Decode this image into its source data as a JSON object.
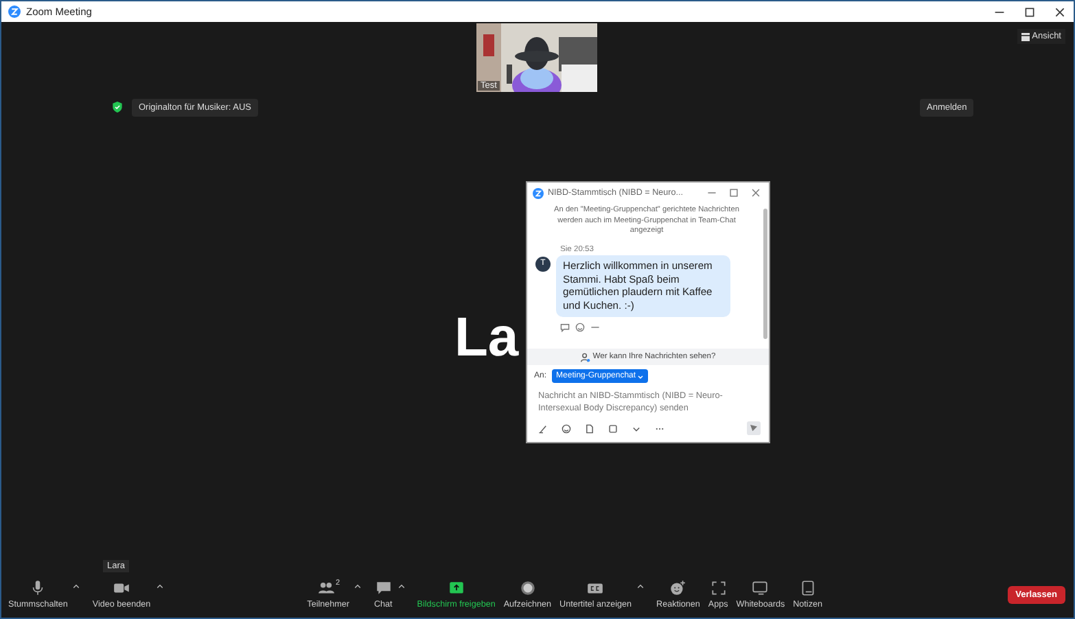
{
  "window": {
    "title": "Zoom Meeting"
  },
  "view_button": {
    "label": "Ansicht"
  },
  "video_tile": {
    "name": "Test"
  },
  "original_sound": {
    "label": "Originalton für Musiker: AUS"
  },
  "sign_in": {
    "label": "Anmelden"
  },
  "speaker_name": "La",
  "chat": {
    "title": "NIBD-Stammtisch (NIBD = Neuro...",
    "notice": "An den \"Meeting-Gruppenchat\" gerichtete Nachrichten werden auch im Meeting-Gruppenchat in Team-Chat angezeigt",
    "messages": [
      {
        "meta": "Sie 20:53",
        "avatar": "T",
        "text": "Herzlich willkommen in unserem Stammi. Habt Spaß beim gemütlichen plaudern mit Kaffee und Kuchen. :-)"
      }
    ],
    "privacy_link": "Wer kann Ihre Nachrichten sehen?",
    "to_label": "An:",
    "recipient": "Meeting-Gruppenchat",
    "placeholder": "Nachricht an NIBD-Stammtisch (NIBD = Neuro-Intersexual Body Discrepancy) senden"
  },
  "name_tooltip": "Lara",
  "toolbar_left": [
    {
      "kind": "mic",
      "label": "Stummschalten",
      "caret": true
    },
    {
      "kind": "video",
      "label": "Video beenden",
      "caret": true
    }
  ],
  "toolbar_center": [
    {
      "kind": "participants",
      "label": "Teilnehmer",
      "badge": "2",
      "caret": true
    },
    {
      "kind": "chat",
      "label": "Chat",
      "caret": true
    },
    {
      "kind": "share",
      "label": "Bildschirm freigeben",
      "caret": false
    },
    {
      "kind": "record",
      "label": "Aufzeichnen",
      "caret": false
    },
    {
      "kind": "captions",
      "label": "Untertitel anzeigen",
      "caret": true
    },
    {
      "kind": "reactions",
      "label": "Reaktionen",
      "caret": false
    },
    {
      "kind": "apps",
      "label": "Apps",
      "caret": false
    },
    {
      "kind": "whiteboard",
      "label": "Whiteboards",
      "caret": false
    },
    {
      "kind": "notes",
      "label": "Notizen",
      "caret": false
    }
  ],
  "leave_button": {
    "label": "Verlassen"
  }
}
